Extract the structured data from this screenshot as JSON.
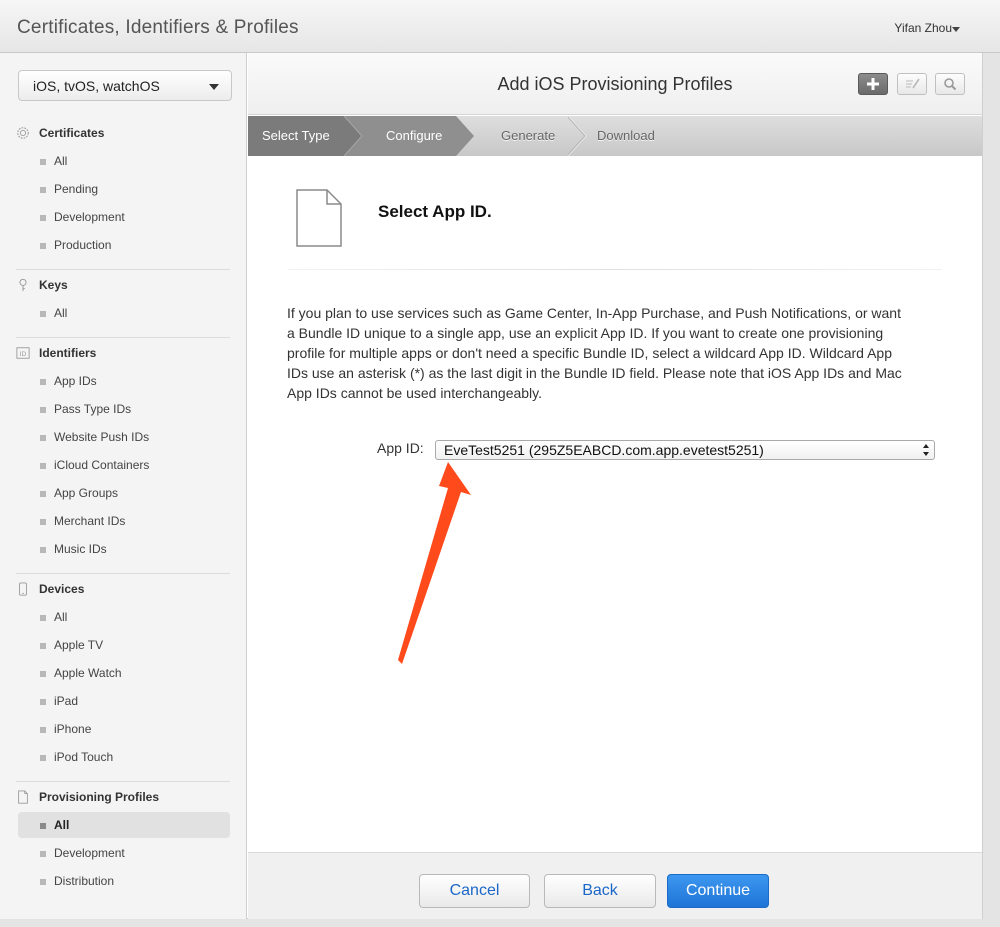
{
  "topbar": {
    "title": "Certificates, Identifiers & Profiles",
    "user": "Yifan Zhou"
  },
  "sidebar": {
    "platform": "iOS, tvOS, watchOS",
    "sections": [
      {
        "label": "Certificates",
        "icon": "certificate-icon",
        "items": [
          "All",
          "Pending",
          "Development",
          "Production"
        ]
      },
      {
        "label": "Keys",
        "icon": "key-icon",
        "items": [
          "All"
        ]
      },
      {
        "label": "Identifiers",
        "icon": "id-icon",
        "items": [
          "App IDs",
          "Pass Type IDs",
          "Website Push IDs",
          "iCloud Containers",
          "App Groups",
          "Merchant IDs",
          "Music IDs"
        ]
      },
      {
        "label": "Devices",
        "icon": "device-icon",
        "items": [
          "All",
          "Apple TV",
          "Apple Watch",
          "iPad",
          "iPhone",
          "iPod Touch"
        ]
      },
      {
        "label": "Provisioning Profiles",
        "icon": "document-icon",
        "items": [
          "All",
          "Development",
          "Distribution"
        ]
      }
    ],
    "active": "Provisioning Profiles / All"
  },
  "header": {
    "title": "Add iOS Provisioning Profiles"
  },
  "steps": [
    "Select Type",
    "Configure",
    "Generate",
    "Download"
  ],
  "content": {
    "heading": "Select App ID.",
    "paragraph": "If you plan to use services such as Game Center, In-App Purchase, and Push Notifications, or want a Bundle ID unique to a single app, use an explicit App ID. If you want to create one provisioning profile for multiple apps or don't need a specific Bundle ID, select a wildcard App ID. Wildcard App IDs use an asterisk (*) as the last digit in the Bundle ID field. Please note that iOS App IDs and Mac App IDs cannot be used interchangeably.",
    "app_id_label": "App ID:",
    "app_id_value": "EveTest5251 (295Z5EABCD.com.app.evetest5251)"
  },
  "footer": {
    "cancel": "Cancel",
    "back": "Back",
    "continue": "Continue"
  },
  "colors": {
    "accent": "#1f74d6",
    "annotation_arrow": "#ff4a1c"
  }
}
